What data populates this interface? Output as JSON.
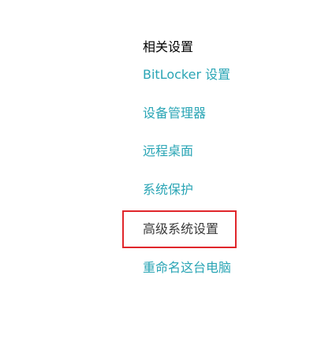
{
  "related_settings": {
    "title": "相关设置",
    "links": [
      {
        "label": "BitLocker 设置"
      },
      {
        "label": "设备管理器"
      },
      {
        "label": "远程桌面"
      },
      {
        "label": "系统保护"
      },
      {
        "label": "高级系统设置",
        "highlighted": true
      },
      {
        "label": "重命名这台电脑"
      }
    ]
  },
  "colors": {
    "link": "#2aa5b5",
    "highlighted_link": "#3a3a3a",
    "annotation_border": "#e0262b",
    "title": "#000000",
    "background": "#ffffff"
  }
}
